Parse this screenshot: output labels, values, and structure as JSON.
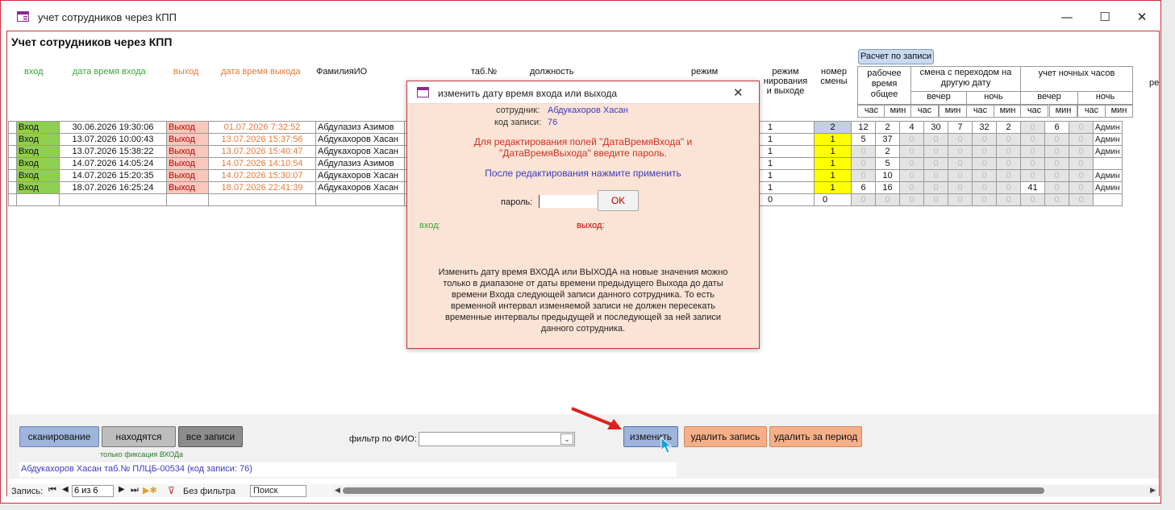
{
  "window": {
    "title": "учет сотрудников через КПП",
    "minimize": "—",
    "maximize": "☐",
    "close": "✕"
  },
  "form": {
    "title": "Учет сотрудников через КПП"
  },
  "columns": {
    "vhod": "вход",
    "data_vhoda": "дата время входа",
    "vyhod": "выход",
    "data_vyhoda": "дата время выхода",
    "fio": "ФамилияИО",
    "tab": "таб.№",
    "dolzh": "должность",
    "rezhim": "режим",
    "rezhim2": "режим",
    "rezhim2b": "нирования",
    "rezhim2c": "и выходе",
    "nomer": "номер",
    "nomer2": "смены",
    "rab": "рабочее",
    "rab2": "время",
    "rab3": "общее",
    "smena": "смена с переходом на",
    "smena2": "другую дату",
    "nochn": "учет ночных часов",
    "vecher": "вечер",
    "noch": "ночь",
    "vecher2": "вечер",
    "noch2": "ночь",
    "chas": "час",
    "min": "мин",
    "extra": "ре"
  },
  "calc_button": "Расчет по записи",
  "colors": {
    "in": "#8fcf50",
    "out_bg": "#f8c8bd",
    "out_text": "#c00000",
    "out_date": "#e07a3a",
    "accent": "#c9323c"
  },
  "rows": [
    {
      "vhod": "Вход",
      "dt_in": "30.06.2026 19:30:06",
      "vyhod": "Выход",
      "dt_out": "01.07.2026 7:32:52",
      "fio": "Абдулазиз Азимов",
      "rezhim": "1",
      "smena": "2",
      "h": "12",
      "m": "2",
      "c1": "4",
      "c2": "30",
      "c3": "7",
      "c4": "32",
      "n1": "2",
      "n2": "0",
      "n3": "6",
      "n4": "0",
      "tail": "Админ"
    },
    {
      "vhod": "Вход",
      "dt_in": "13.07.2026 10:00:43",
      "vyhod": "Выход",
      "dt_out": "13.07.2026 15:37:56",
      "fio": "Абдукахоров Хасан",
      "rezhim": "1",
      "smena": "1",
      "h": "5",
      "m": "37",
      "c1": "0",
      "c2": "0",
      "c3": "0",
      "c4": "0",
      "n1": "0",
      "n2": "0",
      "n3": "0",
      "n4": "0",
      "tail": "Админ"
    },
    {
      "vhod": "Вход",
      "dt_in": "13.07.2026 15:38:22",
      "vyhod": "Выход",
      "dt_out": "13.07.2026 15:40:47",
      "fio": "Абдукахоров Хасан",
      "rezhim": "1",
      "smena": "1",
      "h": "0",
      "m": "2",
      "c1": "0",
      "c2": "0",
      "c3": "0",
      "c4": "0",
      "n1": "0",
      "n2": "0",
      "n3": "0",
      "n4": "0",
      "tail": "Админ"
    },
    {
      "vhod": "Вход",
      "dt_in": "14.07.2026 14:05:24",
      "vyhod": "Выход",
      "dt_out": "14.07.2026 14:10:54",
      "fio": "Абдулазиз Азимов",
      "rezhim": "1",
      "smena": "1",
      "h": "0",
      "m": "5",
      "c1": "0",
      "c2": "0",
      "c3": "0",
      "c4": "0",
      "n1": "0",
      "n2": "0",
      "n3": "0",
      "n4": "0",
      "tail": ""
    },
    {
      "vhod": "Вход",
      "dt_in": "14.07.2026 15:20:35",
      "vyhod": "Выход",
      "dt_out": "14.07.2026 15:30:07",
      "fio": "Абдукахоров Хасан",
      "rezhim": "1",
      "smena": "1",
      "h": "0",
      "m": "10",
      "c1": "0",
      "c2": "0",
      "c3": "0",
      "c4": "0",
      "n1": "0",
      "n2": "0",
      "n3": "0",
      "n4": "0",
      "tail": "Админ"
    },
    {
      "vhod": "Вход",
      "dt_in": "18.07.2026 16:25:24",
      "vyhod": "Выход",
      "dt_out": "18.07.2026 22:41:39",
      "fio": "Абдукахоров Хасан",
      "rezhim": "1",
      "smena": "1",
      "h": "6",
      "m": "16",
      "c1": "0",
      "c2": "0",
      "c3": "0",
      "c4": "0",
      "n1": "0",
      "n2": "41",
      "n3": "0",
      "n4": "0",
      "tail": "Админ"
    },
    {
      "vhod": "",
      "dt_in": "",
      "vyhod": "",
      "dt_out": "",
      "fio": "",
      "rezhim": "0",
      "smena": "0",
      "h": "0",
      "m": "0",
      "c1": "0",
      "c2": "0",
      "c3": "0",
      "c4": "0",
      "n1": "0",
      "n2": "0",
      "n3": "0",
      "n4": "0",
      "tail": ""
    }
  ],
  "modal": {
    "title": "изменить дату время входа или выхода",
    "emp_label": "сотрудник:",
    "emp_value": "Абдукахоров Хасан",
    "code_label": "код записи:",
    "code_value": "76",
    "warn1": "Для редактирования полей \"ДатаВремяВхода\"  и",
    "warn2": "\"ДатаВремяВыхода\" введите пароль.",
    "after": "После редактирования нажмите применить",
    "pass_label": "пароль:",
    "ok": "OK",
    "vhod": "вход:",
    "vyhod": "выход:",
    "info1": "Изменить дату время ВХОДА или ВЫХОДА на новые значения можно",
    "info2": "только в диапазоне от даты времени предыдущего Выхода до даты",
    "info3": "времени Входа следующей записи данного сотрудника. То есть",
    "info4": "временной интервал изменяемой записи не должен пересекать",
    "info5": "временные интервалы предыдущей и последующей за ней записи",
    "info6": "данного сотрудника."
  },
  "footer": {
    "scan": "сканирование",
    "inside": "находятся",
    "all": "все записи",
    "only_in": "только фиксация ВХОДа",
    "filter_label": "фильтр по ФИО:",
    "edit": "изменить",
    "del": "удалить запись",
    "del_period": "удалить за период",
    "status": "Абдукахоров Хасан  таб.№ ПЛЦБ-00534  (код записи: 76)"
  },
  "nav": {
    "label": "Запись:",
    "pos": "6 из 6",
    "nofilter": "Без фильтра",
    "search": "Поиск"
  }
}
